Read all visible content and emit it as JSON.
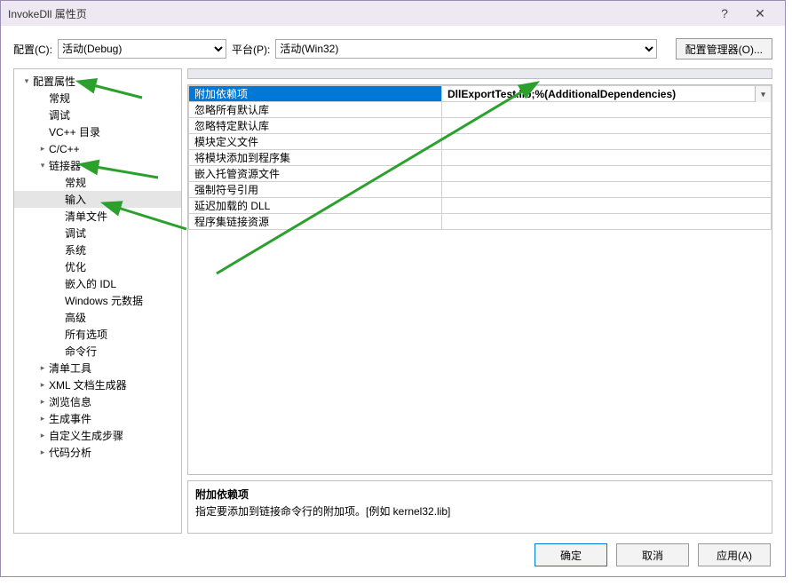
{
  "title": "InvokeDll 属性页",
  "help_btn": "?",
  "toolbar": {
    "config_label": "配置(C):",
    "config_value": "活动(Debug)",
    "platform_label": "平台(P):",
    "platform_value": "活动(Win32)",
    "config_mgr": "配置管理器(O)..."
  },
  "tree": [
    {
      "lvl": 0,
      "expand": "▾",
      "label": "配置属性"
    },
    {
      "lvl": 1,
      "expand": "",
      "label": "常规"
    },
    {
      "lvl": 1,
      "expand": "",
      "label": "调试"
    },
    {
      "lvl": 1,
      "expand": "",
      "label": "VC++ 目录"
    },
    {
      "lvl": 1,
      "expand": "▸",
      "label": "C/C++"
    },
    {
      "lvl": 1,
      "expand": "▾",
      "label": "链接器"
    },
    {
      "lvl": 2,
      "expand": "",
      "label": "常规"
    },
    {
      "lvl": 2,
      "expand": "",
      "label": "输入",
      "selected": true
    },
    {
      "lvl": 2,
      "expand": "",
      "label": "清单文件"
    },
    {
      "lvl": 2,
      "expand": "",
      "label": "调试"
    },
    {
      "lvl": 2,
      "expand": "",
      "label": "系统"
    },
    {
      "lvl": 2,
      "expand": "",
      "label": "优化"
    },
    {
      "lvl": 2,
      "expand": "",
      "label": "嵌入的 IDL"
    },
    {
      "lvl": 2,
      "expand": "",
      "label": "Windows 元数据"
    },
    {
      "lvl": 2,
      "expand": "",
      "label": "高级"
    },
    {
      "lvl": 2,
      "expand": "",
      "label": "所有选项"
    },
    {
      "lvl": 2,
      "expand": "",
      "label": "命令行"
    },
    {
      "lvl": 1,
      "expand": "▸",
      "label": "清单工具"
    },
    {
      "lvl": 1,
      "expand": "▸",
      "label": "XML 文档生成器"
    },
    {
      "lvl": 1,
      "expand": "▸",
      "label": "浏览信息"
    },
    {
      "lvl": 1,
      "expand": "▸",
      "label": "生成事件"
    },
    {
      "lvl": 1,
      "expand": "▸",
      "label": "自定义生成步骤"
    },
    {
      "lvl": 1,
      "expand": "▸",
      "label": "代码分析"
    }
  ],
  "grid_rows": [
    {
      "name": "附加依赖项",
      "value": "DllExportTest.lib;%(AdditionalDependencies)",
      "selected": true,
      "dropdown": true
    },
    {
      "name": "忽略所有默认库",
      "value": ""
    },
    {
      "name": "忽略特定默认库",
      "value": ""
    },
    {
      "name": "模块定义文件",
      "value": ""
    },
    {
      "name": "将模块添加到程序集",
      "value": ""
    },
    {
      "name": "嵌入托管资源文件",
      "value": ""
    },
    {
      "name": "强制符号引用",
      "value": ""
    },
    {
      "name": "延迟加载的 DLL",
      "value": ""
    },
    {
      "name": "程序集链接资源",
      "value": ""
    }
  ],
  "description": {
    "title": "附加依赖项",
    "body": "指定要添加到链接命令行的附加项。[例如 kernel32.lib]"
  },
  "buttons": {
    "ok": "确定",
    "cancel": "取消",
    "apply": "应用(A)"
  }
}
